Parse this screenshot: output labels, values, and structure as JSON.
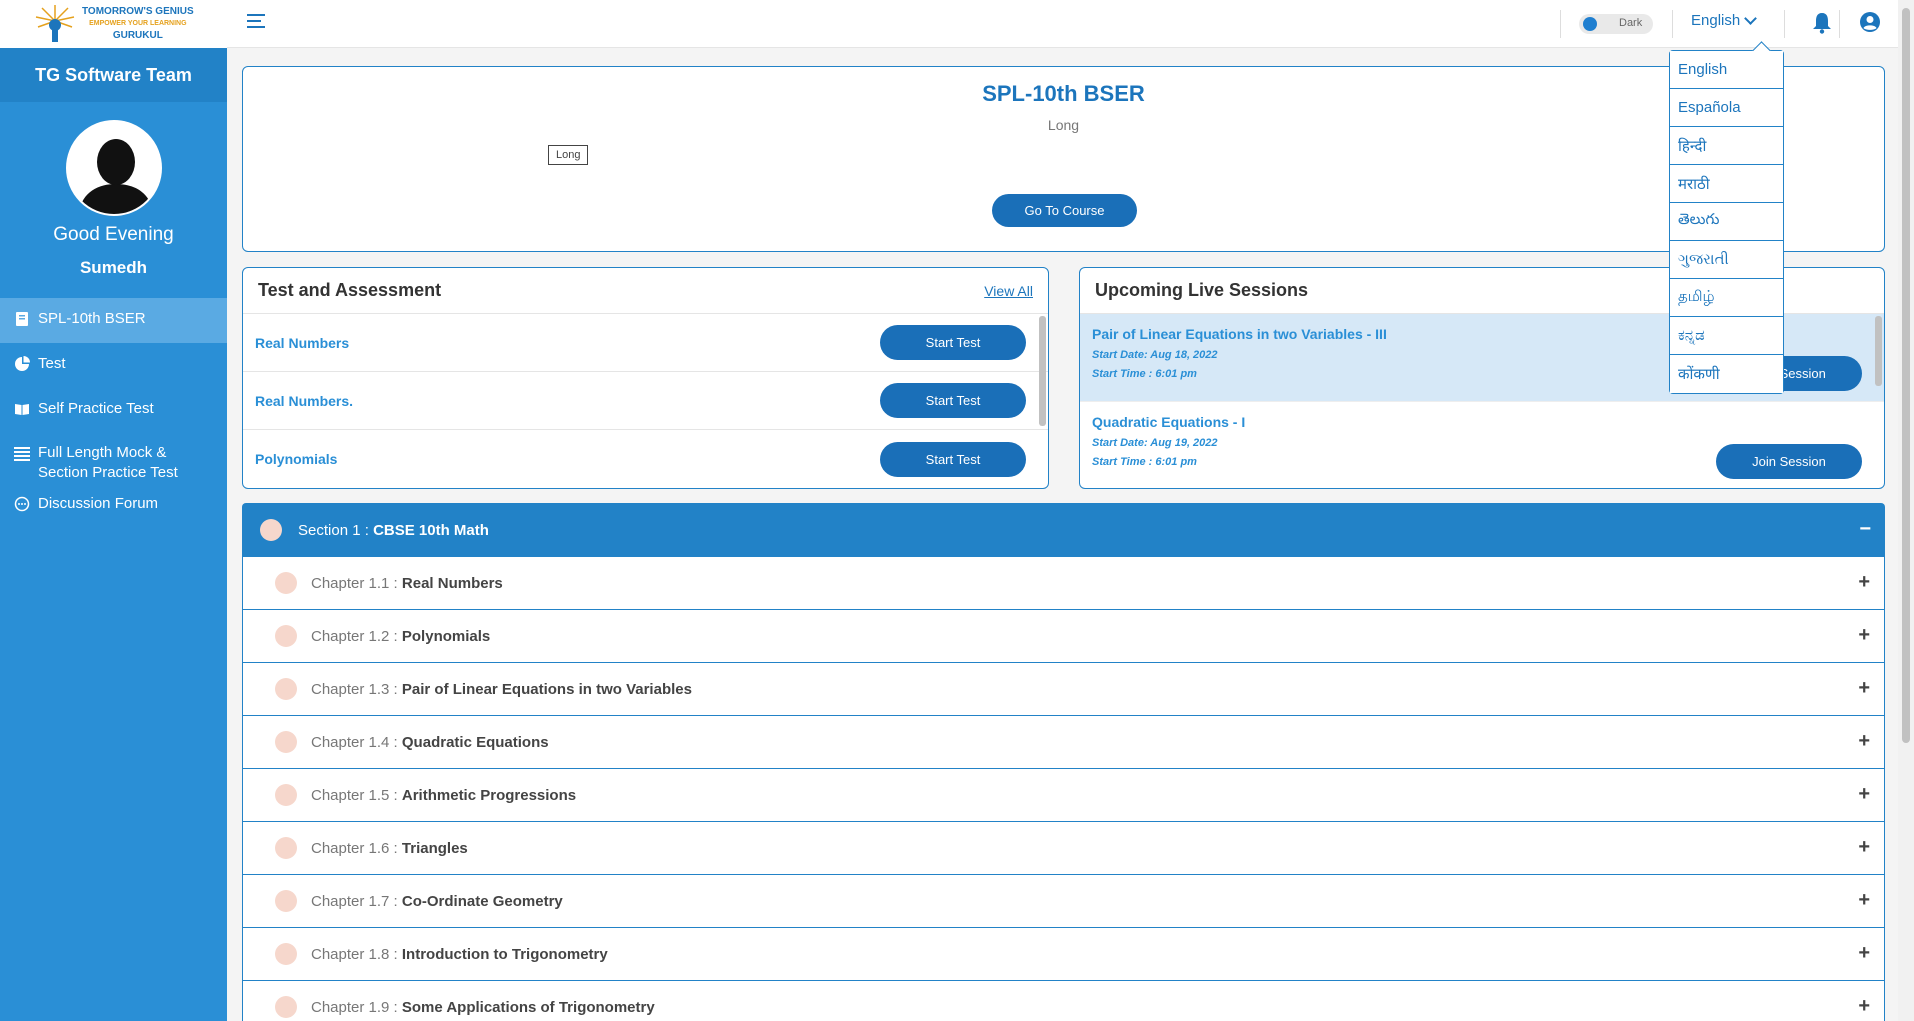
{
  "logo": {
    "line1": "TOMORROW'S GENIUS",
    "line2": "EMPOWER YOUR LEARNING",
    "line3": "GURUKUL"
  },
  "sidebar": {
    "team": "TG Software Team",
    "greeting": "Good Evening",
    "user_name": "Sumedh",
    "items": [
      {
        "label": "SPL-10th BSER",
        "icon": "book-icon"
      },
      {
        "label": "Test",
        "icon": "pie-chart-icon"
      },
      {
        "label": "Self Practice Test",
        "icon": "open-book-icon"
      },
      {
        "label": "Full Length Mock & Section Practice Test",
        "icon": "list-icon"
      },
      {
        "label": "Discussion Forum",
        "icon": "chat-icon"
      }
    ]
  },
  "topbar": {
    "theme_toggle": "Dark",
    "language": "English"
  },
  "language_menu": [
    "English",
    "Española",
    "हिन्दी",
    "मराठी",
    "తెలుగు",
    "ગુજરાતી",
    "தமிழ்",
    "ಕನ್ನಡ",
    "कोंकणी"
  ],
  "course": {
    "title": "SPL-10th BSER",
    "subtitle": "Long",
    "tag": "Long",
    "button": "Go To Course"
  },
  "tests": {
    "title": "Test and Assessment",
    "view_all": "View All",
    "rows": [
      {
        "name": "Real Numbers",
        "action": "Start Test"
      },
      {
        "name": "Real Numbers.",
        "action": "Start Test"
      },
      {
        "name": "Polynomials",
        "action": "Start Test"
      }
    ]
  },
  "sessions": {
    "title": "Upcoming Live Sessions",
    "rows": [
      {
        "name": "Pair of Linear Equations in two Variables - III",
        "date": "Start Date: Aug 18, 2022",
        "time": "Start Time : 6:01 pm",
        "action": "Join Session"
      },
      {
        "name": "Quadratic Equations - I",
        "date": "Start Date: Aug 19, 2022",
        "time": "Start Time : 6:01 pm",
        "action": "Join Session"
      }
    ]
  },
  "section": {
    "prefix": "Section 1 :",
    "name": "CBSE 10th Math",
    "chapters": [
      {
        "prefix": "Chapter  1.1 :",
        "name": "Real Numbers"
      },
      {
        "prefix": "Chapter  1.2 :",
        "name": "Polynomials"
      },
      {
        "prefix": "Chapter  1.3 :",
        "name": "Pair of Linear Equations in two Variables"
      },
      {
        "prefix": "Chapter  1.4 :",
        "name": "Quadratic Equations"
      },
      {
        "prefix": "Chapter  1.5 :",
        "name": "Arithmetic Progressions"
      },
      {
        "prefix": "Chapter  1.6 :",
        "name": "Triangles"
      },
      {
        "prefix": "Chapter  1.7 :",
        "name": "Co-Ordinate Geometry"
      },
      {
        "prefix": "Chapter  1.8 :",
        "name": "Introduction to Trigonometry"
      },
      {
        "prefix": "Chapter  1.9 :",
        "name": "Some Applications of Trigonometry"
      }
    ]
  },
  "colors": {
    "primary": "#2282c7",
    "sidebar": "#2a8fd6",
    "button": "#1a6fb8",
    "active_nav": "#5aaae3"
  }
}
